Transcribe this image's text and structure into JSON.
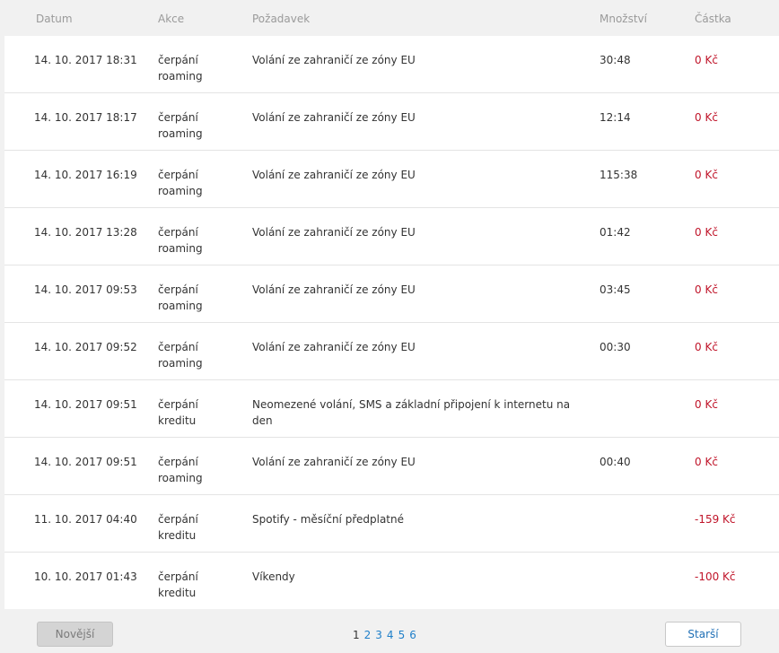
{
  "header": {
    "date": "Datum",
    "action": "Akce",
    "request": "Požadavek",
    "quantity": "Množství",
    "amount": "Částka"
  },
  "rows": [
    {
      "date": "14. 10. 2017 18:31",
      "action": "čerpání roaming",
      "request": "Volání ze zahraničí ze zóny EU",
      "quantity": "30:48",
      "amount": "0 Kč"
    },
    {
      "date": "14. 10. 2017 18:17",
      "action": "čerpání roaming",
      "request": "Volání ze zahraničí ze zóny EU",
      "quantity": "12:14",
      "amount": "0 Kč"
    },
    {
      "date": "14. 10. 2017 16:19",
      "action": "čerpání roaming",
      "request": "Volání ze zahraničí ze zóny EU",
      "quantity": "115:38",
      "amount": "0 Kč"
    },
    {
      "date": "14. 10. 2017 13:28",
      "action": "čerpání roaming",
      "request": "Volání ze zahraničí ze zóny EU",
      "quantity": "01:42",
      "amount": "0 Kč"
    },
    {
      "date": "14. 10. 2017 09:53",
      "action": "čerpání roaming",
      "request": "Volání ze zahraničí ze zóny EU",
      "quantity": "03:45",
      "amount": "0 Kč"
    },
    {
      "date": "14. 10. 2017 09:52",
      "action": "čerpání roaming",
      "request": "Volání ze zahraničí ze zóny EU",
      "quantity": "00:30",
      "amount": "0 Kč"
    },
    {
      "date": "14. 10. 2017 09:51",
      "action": "čerpání kreditu",
      "request": "Neomezené volání, SMS a základní připojení k internetu na den",
      "quantity": "",
      "amount": "0 Kč"
    },
    {
      "date": "14. 10. 2017 09:51",
      "action": "čerpání roaming",
      "request": "Volání ze zahraničí ze zóny EU",
      "quantity": "00:40",
      "amount": "0 Kč"
    },
    {
      "date": "11. 10. 2017 04:40",
      "action": "čerpání kreditu",
      "request": "Spotify - měsíční předplatné",
      "quantity": "",
      "amount": "-159 Kč"
    },
    {
      "date": "10. 10. 2017 01:43",
      "action": "čerpání kreditu",
      "request": "Víkendy",
      "quantity": "",
      "amount": "-100 Kč"
    }
  ],
  "pagination": {
    "newer_label": "Novější",
    "older_label": "Starší",
    "pages": [
      "1",
      "2",
      "3",
      "4",
      "5",
      "6"
    ],
    "current_page": "1"
  },
  "colors": {
    "amount": "#c0152a",
    "link": "#1f7fc9",
    "background": "#f1f1f1"
  }
}
